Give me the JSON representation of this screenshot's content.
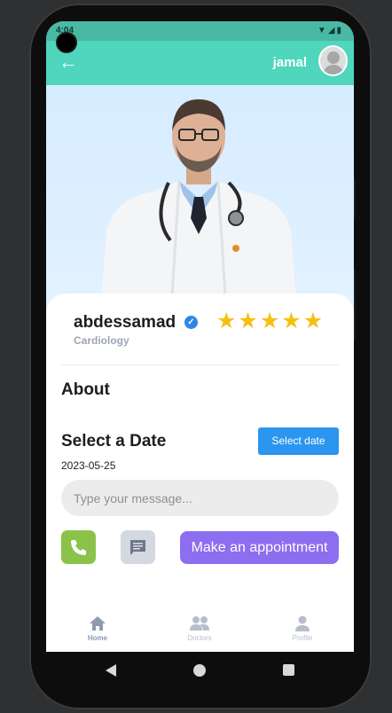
{
  "status_bar": {
    "time": "4:04",
    "icons": "▼◢▮"
  },
  "app_bar": {
    "back_glyph": "←",
    "username": "jamal"
  },
  "doctor": {
    "name": "abdessamad",
    "verified_glyph": "✓",
    "specialty": "Cardiology",
    "rating": 5,
    "stars": [
      "★",
      "★",
      "★",
      "★",
      "★"
    ]
  },
  "about": {
    "title": "About"
  },
  "date_section": {
    "title": "Select a Date",
    "button_label": "Select date",
    "selected_date": "2023-05-25"
  },
  "message": {
    "placeholder": "Type your message...",
    "value": ""
  },
  "actions": {
    "call_icon": "phone-icon",
    "chat_icon": "chat-icon",
    "appointment_label": "Make an appointment"
  },
  "bottom_nav": {
    "items": [
      {
        "label": "Home",
        "icon": "home-icon",
        "active": true
      },
      {
        "label": "Doctors",
        "icon": "group-icon",
        "active": false
      },
      {
        "label": "Profile",
        "icon": "person-icon",
        "active": false
      }
    ]
  },
  "colors": {
    "app_bar": "#4fd6bd",
    "status_bar": "#49b9a4",
    "star": "#f6bf12",
    "select_button": "#2b96ef",
    "call_button": "#8bc34a",
    "appointment_button": "#8d6df0",
    "verified": "#2e86e6"
  }
}
